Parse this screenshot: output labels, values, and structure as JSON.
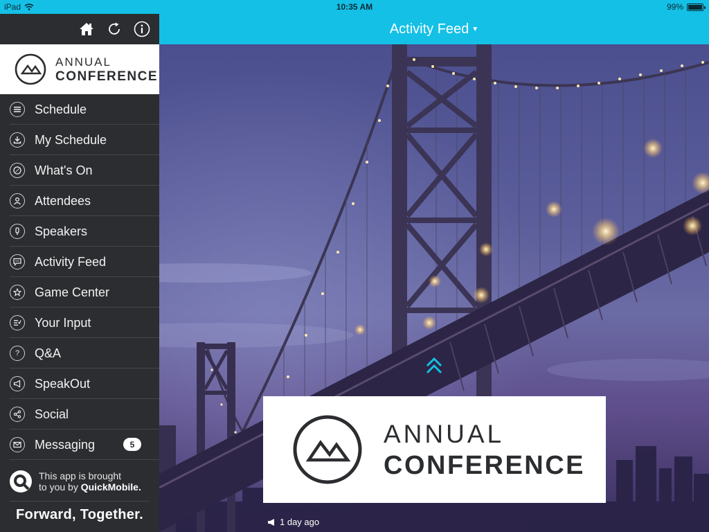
{
  "status_bar": {
    "device": "iPad",
    "time": "10:35 AM",
    "battery_percent": "99%",
    "battery_level": 0.99
  },
  "sidebar": {
    "top_icons": [
      "home-icon",
      "refresh-icon",
      "info-icon"
    ],
    "logo": {
      "line1": "ANNUAL",
      "line2": "CONFERENCE"
    },
    "items": [
      {
        "label": "Schedule",
        "icon": "list-icon"
      },
      {
        "label": "My Schedule",
        "icon": "download-icon"
      },
      {
        "label": "What's On",
        "icon": "compass-icon"
      },
      {
        "label": "Attendees",
        "icon": "person-icon"
      },
      {
        "label": "Speakers",
        "icon": "microphone-icon"
      },
      {
        "label": "Activity Feed",
        "icon": "chat-icon"
      },
      {
        "label": "Game Center",
        "icon": "star-icon"
      },
      {
        "label": "Your Input",
        "icon": "checklist-icon"
      },
      {
        "label": "Q&A",
        "icon": "question-icon"
      },
      {
        "label": "SpeakOut",
        "icon": "megaphone-icon"
      },
      {
        "label": "Social",
        "icon": "share-icon"
      },
      {
        "label": "Messaging",
        "icon": "envelope-icon",
        "badge": "5"
      }
    ],
    "footer": {
      "line1": "This app is brought",
      "line2_prefix": "to you by ",
      "brand": "QuickMobile.",
      "tagline": "Forward, Together."
    }
  },
  "header": {
    "title": "Activity Feed"
  },
  "feed": {
    "card_logo": {
      "line1": "ANNUAL",
      "line2": "CONFERENCE"
    },
    "timestamp": "1 day ago"
  },
  "colors": {
    "accent": "#14c0e6",
    "sidebar_bg": "#2b2d30",
    "text_light": "#ffffff"
  }
}
